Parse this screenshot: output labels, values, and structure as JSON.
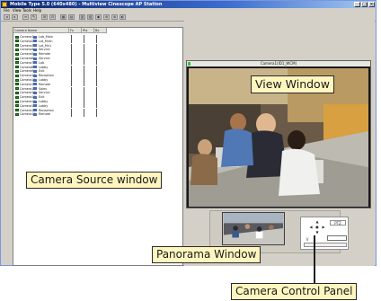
{
  "window": {
    "title": "Mobile Type 5.0 (640x480) - Multiview Cinescope AP Station",
    "controls": [
      "_",
      "□",
      "×"
    ]
  },
  "menubar": {
    "items": [
      "File",
      "View",
      "Tools",
      "Help"
    ]
  },
  "toolbar": {
    "buttons": [
      "◂",
      "▸",
      "≡",
      "✎",
      "⊞",
      "⊟",
      "▦",
      "▤",
      "▥",
      "▧",
      "◉",
      "⊕",
      "⊗",
      "◐"
    ]
  },
  "source_panel": {
    "columns": [
      "Camera Name",
      "Fx",
      "Ptz",
      "Bx"
    ],
    "rows": [
      {
        "name": "Camera1",
        "location": "Lab_Main"
      },
      {
        "name": "Camera2",
        "location": "Lot_Mntn"
      },
      {
        "name": "Camera3",
        "location": "Lot_Mn1"
      },
      {
        "name": "Camera4",
        "location": "Service"
      },
      {
        "name": "Camera5",
        "location": "Remote"
      },
      {
        "name": "Camera6",
        "location": "Service"
      },
      {
        "name": "Camera7",
        "location": "Lab"
      },
      {
        "name": "Camera8",
        "location": "Lobby"
      },
      {
        "name": "Camera9",
        "location": "Exit"
      },
      {
        "name": "Camera10",
        "location": "Reception"
      },
      {
        "name": "Camera11",
        "location": "Lobby"
      },
      {
        "name": "Camera12",
        "location": "Remote"
      },
      {
        "name": "Camera13",
        "location": "Sales"
      },
      {
        "name": "Camera14",
        "location": "Service"
      },
      {
        "name": "Camera15",
        "location": "Exit"
      },
      {
        "name": "Camera16",
        "location": "Lobby"
      },
      {
        "name": "Camera17",
        "location": "Lobby"
      },
      {
        "name": "Camera18",
        "location": "Reception"
      },
      {
        "name": "Camera19",
        "location": "Remote"
      }
    ]
  },
  "view_window": {
    "caption": "Camera1(ID1_WCM)"
  },
  "control_panel": {
    "zoom_label": "Zoom",
    "pan_buttons": [
      "▲",
      "◀",
      "●",
      "▶",
      "▼"
    ],
    "field_label": "V",
    "side_label": "PTZ"
  },
  "callouts": {
    "view_window": "View Window",
    "camera_source": "Camera Source window",
    "panorama": "Panorama Window",
    "camera_control": "Camera Control Panel"
  },
  "colors": {
    "titlebar": "#0a246a",
    "callout_bg": "#fff6bf",
    "status_green": "#39c039"
  }
}
